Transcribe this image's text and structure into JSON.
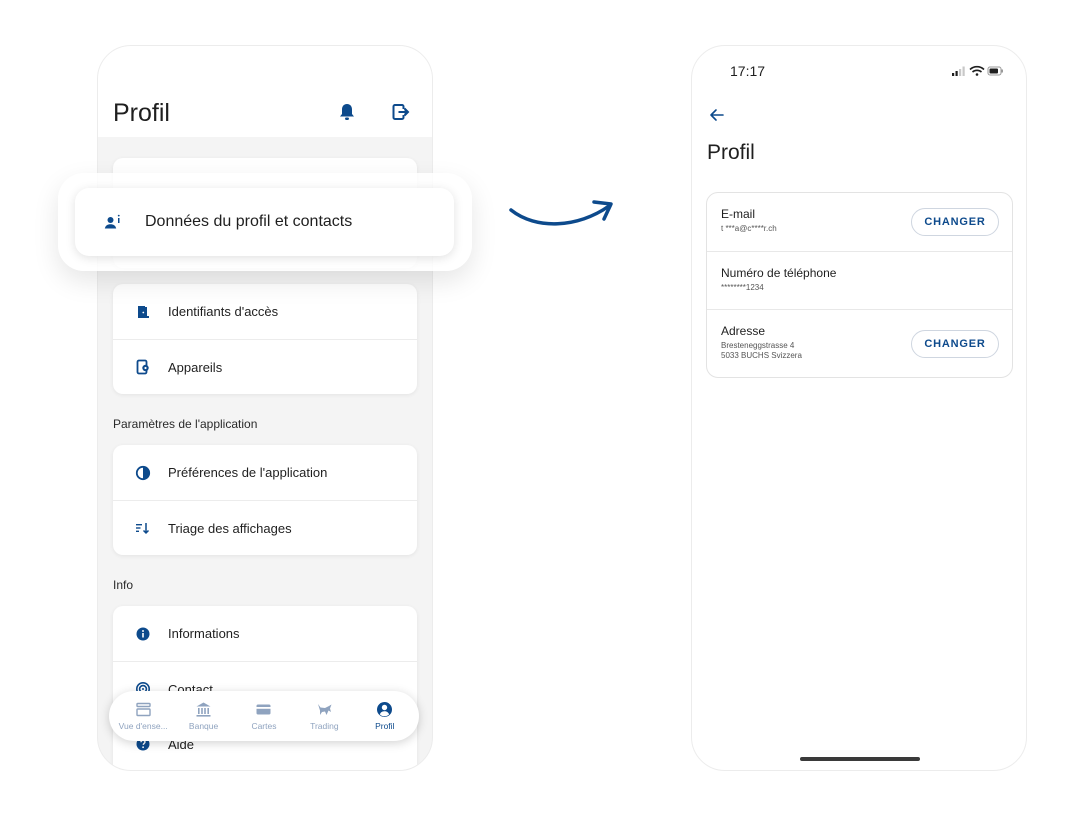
{
  "colors": {
    "accent": "#0d4a8c",
    "nav_inactive": "#8fa3bf"
  },
  "left": {
    "title": "Profil",
    "header_icons": [
      "bell-icon",
      "logout-icon"
    ],
    "card1": {
      "items": [
        {
          "label": "Identifiants d'accès",
          "icon": "door-icon"
        },
        {
          "label": "Appareils",
          "icon": "device-settings-icon"
        }
      ]
    },
    "section_app": "Paramètres de l'application",
    "card2": {
      "items": [
        {
          "label": "Préférences de l'application",
          "icon": "contrast-icon"
        },
        {
          "label": "Triage des affichages",
          "icon": "sort-icon"
        }
      ]
    },
    "section_info": "Info",
    "card3": {
      "items": [
        {
          "label": "Informations",
          "icon": "info-icon"
        },
        {
          "label": "Contact",
          "icon": "contact-icon"
        },
        {
          "label": "Aide",
          "icon": "help-icon"
        }
      ]
    },
    "highlight": {
      "label": "Données du profil et contacts",
      "icon": "person-info-icon"
    },
    "nav": [
      {
        "label": "Vue d'ense...",
        "icon": "overview-icon",
        "active": false
      },
      {
        "label": "Banque",
        "icon": "bank-icon",
        "active": false
      },
      {
        "label": "Cartes",
        "icon": "card-icon",
        "active": false
      },
      {
        "label": "Trading",
        "icon": "bull-icon",
        "active": false
      },
      {
        "label": "Profil",
        "icon": "profile-icon",
        "active": true
      }
    ]
  },
  "right": {
    "status_time": "17:17",
    "title": "Profil",
    "rows": [
      {
        "label": "E-mail",
        "value_lines": [
          "t ***a@c****r.ch"
        ],
        "button": "CHANGER"
      },
      {
        "label": "Numéro de téléphone",
        "value_lines": [
          "********1234"
        ]
      },
      {
        "label": "Adresse",
        "value_lines": [
          "Bresteneggstrasse 4",
          "5033 BUCHS Svizzera"
        ],
        "button": "CHANGER"
      }
    ]
  }
}
